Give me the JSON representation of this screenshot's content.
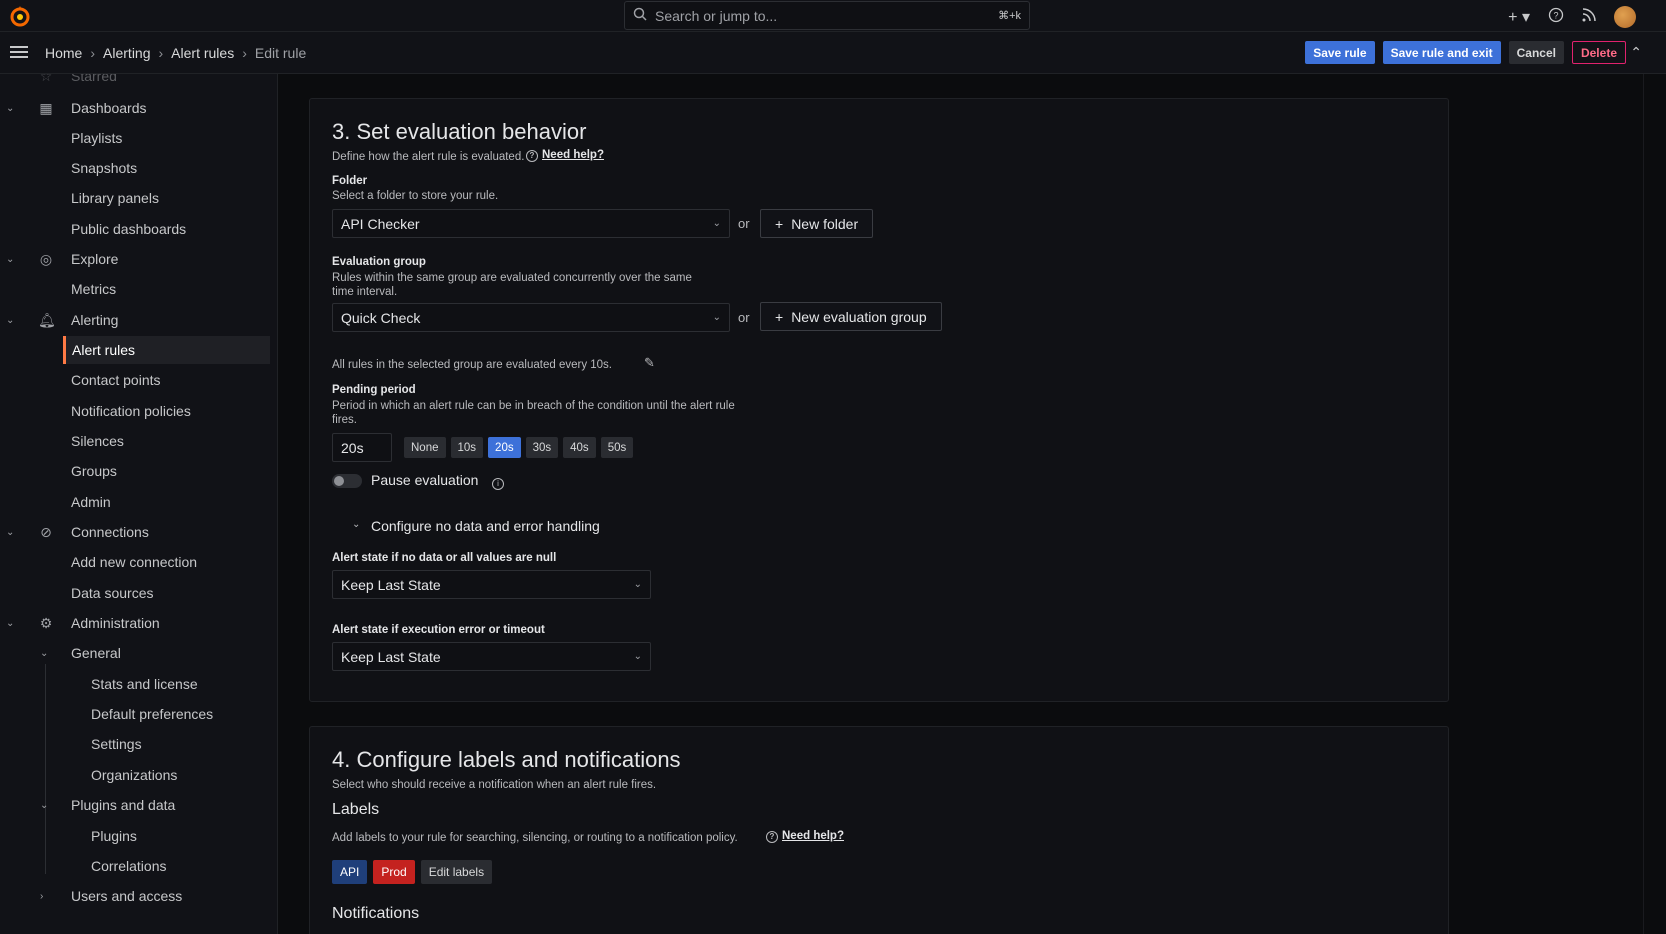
{
  "topbar": {
    "search_placeholder": "Search or jump to...",
    "search_shortcut": "⌘+k",
    "plus_icon": "plus-icon",
    "help_icon": "help-icon",
    "news_icon": "rss-icon"
  },
  "breadcrumb": {
    "items": [
      "Home",
      "Alerting",
      "Alert rules"
    ],
    "current": "Edit rule"
  },
  "actions": {
    "save": "Save rule",
    "save_exit": "Save rule and exit",
    "cancel": "Cancel",
    "delete": "Delete"
  },
  "sidebar": {
    "starred": "Starred",
    "dashboards": "Dashboards",
    "playlists": "Playlists",
    "snapshots": "Snapshots",
    "library_panels": "Library panels",
    "public_dashboards": "Public dashboards",
    "explore": "Explore",
    "metrics": "Metrics",
    "alerting": "Alerting",
    "alert_rules": "Alert rules",
    "contact_points": "Contact points",
    "notification_policies": "Notification policies",
    "silences": "Silences",
    "groups": "Groups",
    "admin": "Admin",
    "connections": "Connections",
    "add_new_connection": "Add new connection",
    "data_sources": "Data sources",
    "administration": "Administration",
    "general": "General",
    "stats_license": "Stats and license",
    "default_prefs": "Default preferences",
    "settings": "Settings",
    "organizations": "Organizations",
    "plugins_data": "Plugins and data",
    "plugins": "Plugins",
    "correlations": "Correlations",
    "users_access": "Users and access"
  },
  "section3": {
    "title": "3. Set evaluation behavior",
    "description": "Define how the alert rule is evaluated.",
    "need_help": "Need help?",
    "folder_label": "Folder",
    "folder_desc": "Select a folder to store your rule.",
    "folder_value": "API Checker",
    "or": "or",
    "new_folder": "New folder",
    "group_label": "Evaluation group",
    "group_desc_1": "Rules within the same group are evaluated concurrently over the same",
    "group_desc_2": "time interval.",
    "group_value": "Quick Check",
    "new_group": "New evaluation group",
    "interval_text": "All rules in the selected group are evaluated every 10s.",
    "pending_label": "Pending period",
    "pending_desc_1": "Period in which an alert rule can be in breach of the condition until the alert rule",
    "pending_desc_2": "fires.",
    "pending_value": "20s",
    "pending_options": [
      "None",
      "10s",
      "20s",
      "30s",
      "40s",
      "50s"
    ],
    "pending_selected": "20s",
    "pause_label": "Pause evaluation",
    "nodata_toggle": "Configure no data and error handling",
    "nodata_label": "Alert state if no data or all values are null",
    "nodata_value": "Keep Last State",
    "error_label": "Alert state if execution error or timeout",
    "error_value": "Keep Last State"
  },
  "section4": {
    "title": "4. Configure labels and notifications",
    "description": "Select who should receive a notification when an alert rule fires.",
    "labels_heading": "Labels",
    "labels_desc": "Add labels to your rule for searching, silencing, or routing to a notification policy.",
    "need_help": "Need help?",
    "label_chips": [
      "API",
      "Prod"
    ],
    "edit_labels": "Edit labels",
    "notifications_heading": "Notifications"
  },
  "colors": {
    "primary": "#3d71d9",
    "active_marker": "#ff7a45",
    "danger": "#e0226e",
    "label_api": "#1f3f7a",
    "label_prod": "#c4221f"
  }
}
